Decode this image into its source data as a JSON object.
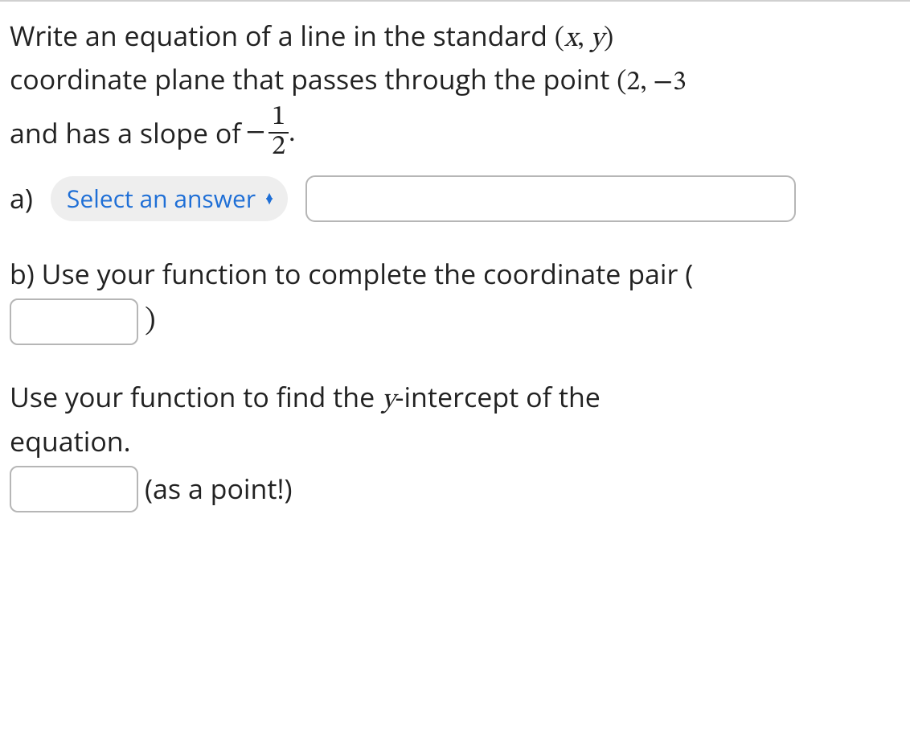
{
  "question": {
    "intro_part1": "Write an equation of a line in the standard ",
    "xy_open": "(",
    "xy_x": "x",
    "xy_comma": ", ",
    "xy_y": "y",
    "xy_close": ")",
    "intro_part2": "coordinate plane that passes through the point ",
    "point_open": "(",
    "point_x": "2",
    "point_comma": ", ",
    "point_y_sign": "−",
    "point_y_partial": "3",
    "intro_part3": "and has a slope of ",
    "slope_sign": "−",
    "slope_num": "1",
    "slope_den": "2",
    "slope_period": "."
  },
  "partA": {
    "label": "a)",
    "select_placeholder": "Select an answer",
    "input_value": ""
  },
  "partB": {
    "line1": "b) Use your function to complete the coordinate pair (",
    "close_paren": ")",
    "input_value": ""
  },
  "partC": {
    "line1a": "Use your function to find the ",
    "y_var": "y",
    "line1b": "-intercept of the",
    "line2": "equation.",
    "hint": "(as a point!)",
    "input_value": ""
  }
}
